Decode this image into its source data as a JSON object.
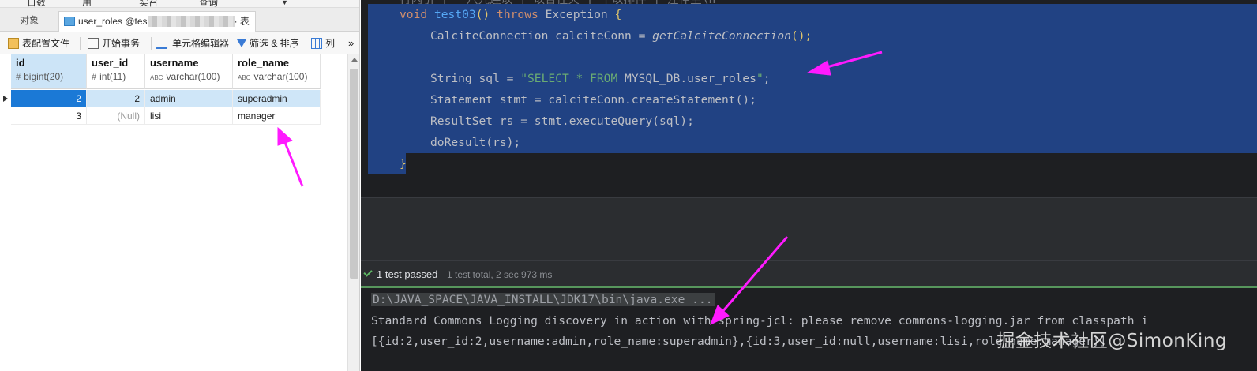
{
  "db_tool": {
    "menu_fragments": [
      "日数",
      "用",
      "实召",
      "查询"
    ],
    "tabs": {
      "objects": "对象",
      "active": "user_roles @tes",
      "active_suffix": "· 表"
    },
    "toolbar": {
      "table_config": "表配置文件",
      "begin_transaction": "开始事务",
      "cell_editor": "单元格编辑器",
      "filter_sort": "筛选 & 排序",
      "columns": "列",
      "overflow": "»"
    },
    "columns": [
      {
        "name": "id",
        "type_icon": "#",
        "type": "bigint(20)"
      },
      {
        "name": "user_id",
        "type_icon": "#",
        "type": "int(11)"
      },
      {
        "name": "username",
        "type_icon": "ABC",
        "type": "varchar(100)"
      },
      {
        "name": "role_name",
        "type_icon": "ABC",
        "type": "varchar(100)"
      }
    ],
    "rows": [
      {
        "id": "2",
        "user_id": "2",
        "username": "admin",
        "role_name": "superadmin"
      },
      {
        "id": "3",
        "user_id": "(Null)",
        "username": "lisi",
        "role_name": "manager"
      }
    ]
  },
  "ide": {
    "code": {
      "comment_fragment": "行内引 | 一八九连以 | 以合住火 | 个以排件 | 注律主\\n",
      "line_method": [
        "void",
        "test03",
        "()",
        "throws",
        "Exception",
        "{"
      ],
      "line_conn": [
        "CalciteConnection calciteConn = ",
        "getCalciteConnection",
        "();"
      ],
      "line_sql": [
        "String sql = ",
        "\"SELECT * FROM ",
        "MYSQL_DB.user_roles",
        "\"",
        ";"
      ],
      "line_stmt": "Statement stmt = calciteConn.createStatement();",
      "line_rs": "ResultSet rs = stmt.executeQuery(sql);",
      "line_do": "doResult(rs);",
      "line_close": "}"
    },
    "run": {
      "status": "1 test passed",
      "summary": "1 test total, 2 sec 973 ms"
    },
    "console": {
      "cmd": "D:\\JAVA_SPACE\\JAVA_INSTALL\\JDK17\\bin\\java.exe ...",
      "line2": "Standard Commons Logging discovery in action with spring-jcl: please remove commons-logging.jar from classpath i",
      "line3": "[{id:2,user_id:2,username:admin,role_name:superadmin},{id:3,user_id:null,username:lisi,role_name:manager}]"
    }
  },
  "watermark": "掘金技术社区@SimonKing",
  "colors": {
    "annotation": "#ff1aff",
    "selection": "#214283",
    "row_focus": "#1b79d6"
  }
}
